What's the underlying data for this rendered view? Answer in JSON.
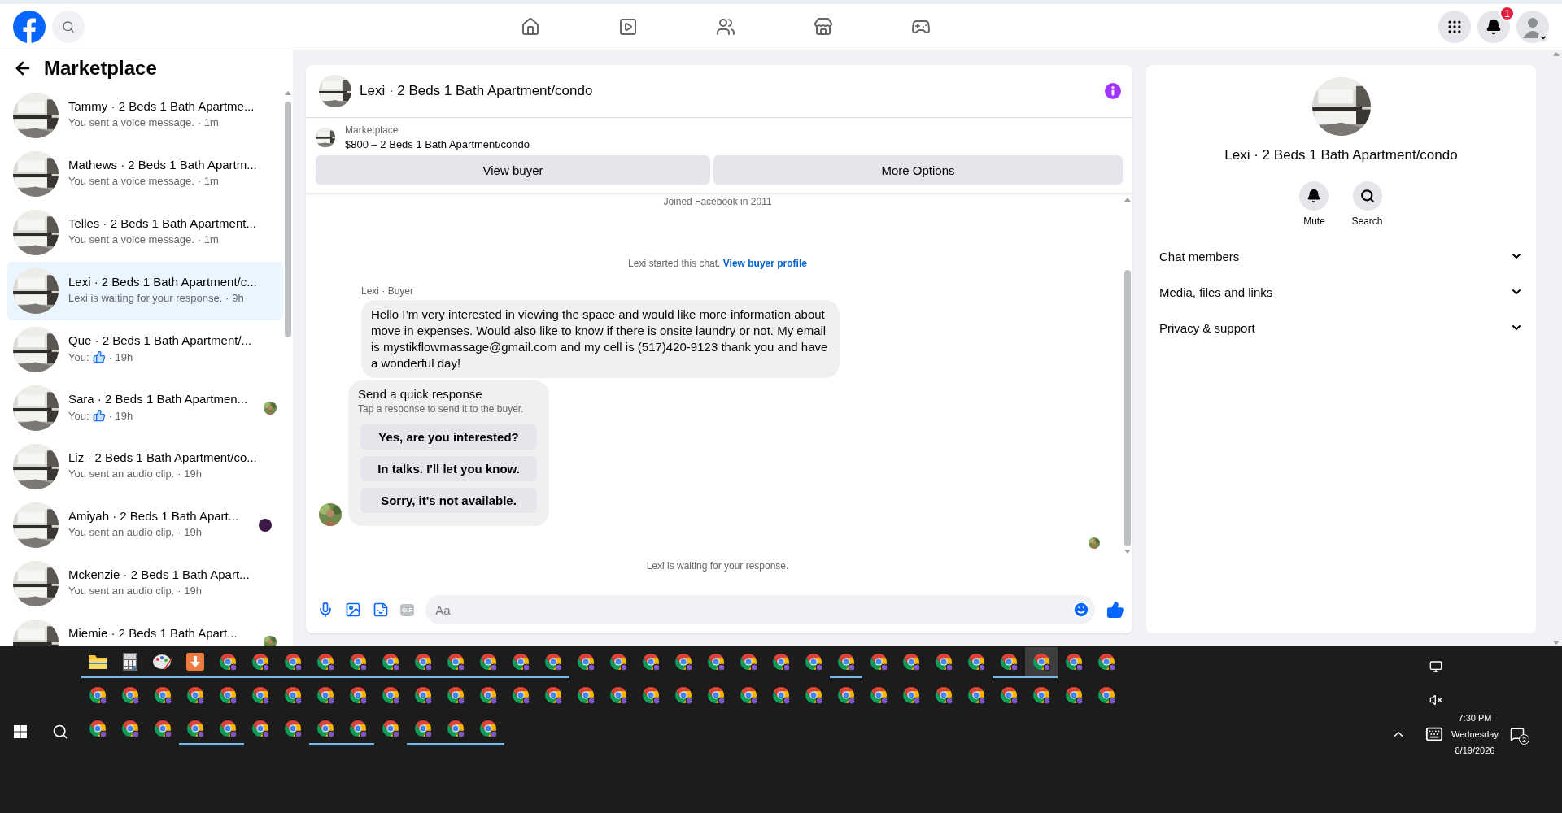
{
  "top_bar": {
    "notification_count": "1"
  },
  "sidebar": {
    "title": "Marketplace",
    "conversations": [
      {
        "name": "Tammy · 2 Beds 1 Bath Apartme...",
        "preview": "You sent a voice message.",
        "like_icon": false,
        "time": "· 1m",
        "selected": false,
        "seen": false,
        "unread": false
      },
      {
        "name": "Mathews · 2 Beds 1 Bath Apartm...",
        "preview": "You sent a voice message.",
        "like_icon": false,
        "time": "· 1m",
        "selected": false,
        "seen": false,
        "unread": false
      },
      {
        "name": "Telles · 2 Beds 1 Bath Apartment...",
        "preview": "You sent a voice message.",
        "like_icon": false,
        "time": "· 1m",
        "selected": false,
        "seen": false,
        "unread": false
      },
      {
        "name": "Lexi · 2 Beds 1 Bath Apartment/c...",
        "preview": "Lexi is waiting for your response.",
        "like_icon": false,
        "time": "· 9h",
        "selected": true,
        "seen": false,
        "unread": false
      },
      {
        "name": "Que · 2 Beds 1 Bath Apartment/...",
        "preview": "You:",
        "like_icon": true,
        "time": "· 19h",
        "selected": false,
        "seen": false,
        "unread": false
      },
      {
        "name": "Sara · 2 Beds 1 Bath Apartmen...",
        "preview": "You:",
        "like_icon": true,
        "time": "· 19h",
        "selected": false,
        "seen": true,
        "unread": false
      },
      {
        "name": "Liz · 2 Beds 1 Bath Apartment/co...",
        "preview": "You sent an audio clip.",
        "like_icon": false,
        "time": "· 19h",
        "selected": false,
        "seen": false,
        "unread": false
      },
      {
        "name": "Amiyah · 2 Beds 1 Bath Apart...",
        "preview": "You sent an audio clip.",
        "like_icon": false,
        "time": "· 19h",
        "selected": false,
        "seen": false,
        "unread": true,
        "color": "#3b1a45"
      },
      {
        "name": "Mckenzie · 2 Beds 1 Bath Apart...",
        "preview": "You sent an audio clip.",
        "like_icon": false,
        "time": "· 19h",
        "selected": false,
        "seen": false,
        "unread": false
      },
      {
        "name": "Miemie · 2 Beds 1 Bath Apart...",
        "selected": false,
        "seen": true,
        "unread": false
      }
    ]
  },
  "chat": {
    "title": "Lexi · 2 Beds 1 Bath Apartment/condo",
    "listing": {
      "source": "Marketplace",
      "summary": "$800 – 2 Beds 1 Bath Apartment/condo"
    },
    "buttons": [
      "View buyer",
      "More Options"
    ],
    "joined": "Joined Facebook in 2011",
    "started": "Lexi started this chat.",
    "started_link": "View buyer profile",
    "sender": "Lexi · Buyer",
    "message": "Hello I’m very interested in viewing the space and would like more information about move in expenses. Would also like to know if there is onsite laundry or not. My email is mystikflowmassage@gmail.com and my cell is (517)420-9123 thank you and have a wonderful day!",
    "quick_response": {
      "title": "Send a quick response",
      "subtitle": "Tap a response to send it to the buyer.",
      "options": [
        "Yes, are you interested?",
        "In talks. I'll let you know.",
        "Sorry, it's not available."
      ]
    },
    "status": "Lexi is waiting for your response.",
    "composer": {
      "placeholder": "Aa",
      "gif_label": "GIF"
    }
  },
  "details": {
    "name": "Lexi · 2 Beds 1 Bath Apartment/condo",
    "actions": [
      {
        "kind": "mute",
        "label": "Mute"
      },
      {
        "kind": "search",
        "label": "Search"
      }
    ],
    "sections": [
      {
        "label": "Chat members",
        "expanded": false
      },
      {
        "label": "Media, files and links",
        "expanded": false
      },
      {
        "label": "Privacy & support",
        "expanded": false
      }
    ]
  },
  "taskbar": {
    "rows": [
      [
        {
          "kind": "folder",
          "open": true,
          "selected": false
        },
        {
          "kind": "calculator",
          "open": true,
          "selected": false
        },
        {
          "kind": "paint",
          "open": true,
          "selected": false
        },
        {
          "kind": "download",
          "open": true,
          "selected": false
        },
        {
          "kind": "browser",
          "open": true,
          "selected": false
        },
        {
          "kind": "browser",
          "open": true,
          "selected": false
        },
        {
          "kind": "browser",
          "open": true,
          "selected": false
        },
        {
          "kind": "browser",
          "open": true,
          "selected": false
        },
        {
          "kind": "browser",
          "open": true,
          "selected": false
        },
        {
          "kind": "browser",
          "open": true,
          "selected": false
        },
        {
          "kind": "browser",
          "open": true,
          "selected": false
        },
        {
          "kind": "browser",
          "open": true,
          "selected": false
        },
        {
          "kind": "browser",
          "open": true,
          "selected": false
        },
        {
          "kind": "browser",
          "open": true,
          "selected": false
        },
        {
          "kind": "browser",
          "open": true,
          "selected": false
        },
        {
          "kind": "browser",
          "open": false,
          "selected": false
        },
        {
          "kind": "browser",
          "open": false,
          "selected": false
        },
        {
          "kind": "browser",
          "open": false,
          "selected": false
        },
        {
          "kind": "browser",
          "open": false,
          "selected": false
        },
        {
          "kind": "browser",
          "open": false,
          "selected": false
        },
        {
          "kind": "browser",
          "open": false,
          "selected": false
        },
        {
          "kind": "browser",
          "open": false,
          "selected": false
        },
        {
          "kind": "browser",
          "open": false,
          "selected": false
        },
        {
          "kind": "browser",
          "open": true,
          "selected": false
        },
        {
          "kind": "browser",
          "open": false,
          "selected": false
        },
        {
          "kind": "browser",
          "open": false,
          "selected": false
        },
        {
          "kind": "browser",
          "open": false,
          "selected": false
        },
        {
          "kind": "browser",
          "open": false,
          "selected": false
        },
        {
          "kind": "browser",
          "open": true,
          "selected": false
        },
        {
          "kind": "browser",
          "open": true,
          "selected": true
        },
        {
          "kind": "browser",
          "open": false,
          "selected": false
        },
        {
          "kind": "browser",
          "open": false,
          "selected": false
        }
      ],
      [
        {
          "kind": "browser",
          "open": false,
          "selected": false
        },
        {
          "kind": "browser",
          "open": false,
          "selected": false
        },
        {
          "kind": "browser",
          "open": false,
          "selected": false
        },
        {
          "kind": "browser",
          "open": false,
          "selected": false
        },
        {
          "kind": "browser",
          "open": false,
          "selected": false
        },
        {
          "kind": "browser",
          "open": false,
          "selected": false
        },
        {
          "kind": "browser",
          "open": false,
          "selected": false
        },
        {
          "kind": "browser",
          "open": false,
          "selected": false
        },
        {
          "kind": "browser",
          "open": false,
          "selected": false
        },
        {
          "kind": "browser",
          "open": false,
          "selected": false
        },
        {
          "kind": "browser",
          "open": false,
          "selected": false
        },
        {
          "kind": "browser",
          "open": false,
          "selected": false
        },
        {
          "kind": "browser",
          "open": false,
          "selected": false
        },
        {
          "kind": "browser",
          "open": false,
          "selected": false
        },
        {
          "kind": "browser",
          "open": false,
          "selected": false
        },
        {
          "kind": "browser",
          "open": false,
          "selected": false
        },
        {
          "kind": "browser",
          "open": false,
          "selected": false
        },
        {
          "kind": "browser",
          "open": false,
          "selected": false
        },
        {
          "kind": "browser",
          "open": false,
          "selected": false
        },
        {
          "kind": "browser",
          "open": false,
          "selected": false
        },
        {
          "kind": "browser",
          "open": false,
          "selected": false
        },
        {
          "kind": "browser",
          "open": false,
          "selected": false
        },
        {
          "kind": "browser",
          "open": false,
          "selected": false
        },
        {
          "kind": "browser",
          "open": false,
          "selected": false
        },
        {
          "kind": "browser",
          "open": false,
          "selected": false
        },
        {
          "kind": "browser",
          "open": false,
          "selected": false
        },
        {
          "kind": "browser",
          "open": false,
          "selected": false
        },
        {
          "kind": "browser",
          "open": false,
          "selected": false
        },
        {
          "kind": "browser",
          "open": false,
          "selected": false
        },
        {
          "kind": "browser",
          "open": false,
          "selected": false
        },
        {
          "kind": "browser",
          "open": false,
          "selected": false
        },
        {
          "kind": "browser",
          "open": false,
          "selected": false
        }
      ],
      [
        {
          "kind": "browser",
          "open": false,
          "selected": false
        },
        {
          "kind": "browser",
          "open": false,
          "selected": false
        },
        {
          "kind": "browser",
          "open": false,
          "selected": false
        },
        {
          "kind": "browser",
          "open": true,
          "selected": false
        },
        {
          "kind": "browser",
          "open": true,
          "selected": false
        },
        {
          "kind": "browser",
          "open": false,
          "selected": false
        },
        {
          "kind": "browser",
          "open": false,
          "selected": false
        },
        {
          "kind": "browser",
          "open": true,
          "selected": false
        },
        {
          "kind": "browser",
          "open": true,
          "selected": false
        },
        {
          "kind": "browser",
          "open": false,
          "selected": false
        },
        {
          "kind": "browser",
          "open": true,
          "selected": false
        },
        {
          "kind": "browser",
          "open": true,
          "selected": false
        },
        {
          "kind": "browser",
          "open": true,
          "selected": false
        }
      ]
    ],
    "tray": {
      "time": "7:30 PM",
      "day": "Wednesday",
      "date": "8/19/2026",
      "notifications": "2"
    }
  }
}
